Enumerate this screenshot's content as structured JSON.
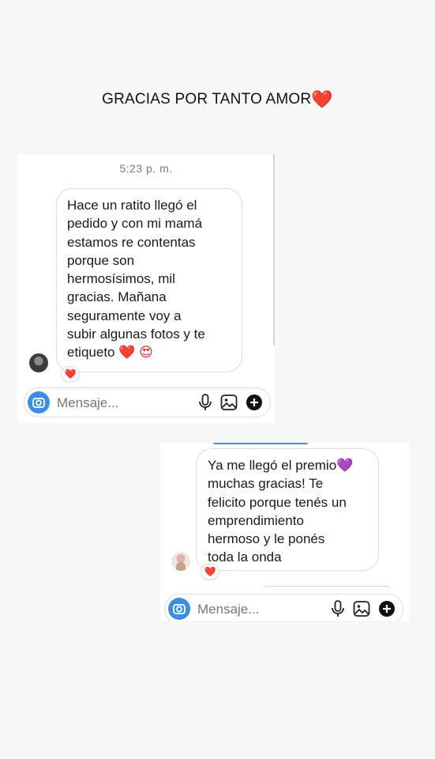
{
  "title": {
    "text": "GRACIAS POR TANTO AMOR",
    "emoji": "❤️"
  },
  "chat1": {
    "timestamp": "5:23 p. m.",
    "message_lines": [
      "Hace un ratito llegó el",
      "pedido y con mi mamá",
      "estamos re contentas",
      "porque son",
      "hermosísimos, mil",
      "gracias. Mañana",
      "seguramente voy a",
      "subir algunas fotos y te",
      "etiqueto"
    ],
    "message_emojis": "❤️ 😍",
    "reaction": "❤️",
    "composer_placeholder": "Mensaje..."
  },
  "chat2": {
    "message_lines": [
      "Ya me llegó el premio",
      "muchas gracias! Te",
      "felicito porque tenés un",
      "emprendimiento",
      "hermoso y le ponés",
      "toda la onda"
    ],
    "message_emoji": "💜",
    "reaction": "❤️",
    "composer_placeholder": "Mensaje..."
  },
  "colors": {
    "accent_blue": "#3b8fe0",
    "heart_red": "#e0202b",
    "heart_purple": "#9b3fe0"
  },
  "icons": [
    "camera-icon",
    "microphone-icon",
    "gallery-icon",
    "plus-icon"
  ]
}
